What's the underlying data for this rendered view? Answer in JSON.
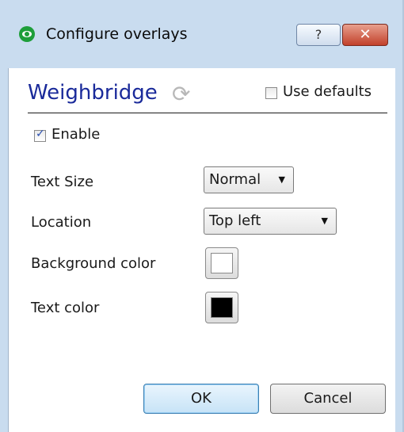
{
  "window": {
    "title": "Configure overlays",
    "help_label": "?",
    "close_label": "✕"
  },
  "header": {
    "title": "Weighbridge",
    "use_defaults_label": "Use defaults",
    "use_defaults_checked": false
  },
  "enable": {
    "label": "Enable",
    "checked": true
  },
  "fields": {
    "text_size": {
      "label": "Text Size",
      "value": "Normal"
    },
    "location": {
      "label": "Location",
      "value": "Top left"
    },
    "background_color": {
      "label": "Background color",
      "color": "#ffffff"
    },
    "text_color": {
      "label": "Text color",
      "color": "#000000"
    }
  },
  "buttons": {
    "ok": "OK",
    "cancel": "Cancel"
  },
  "icons": {
    "app": "eye-icon",
    "refresh": "refresh-arrows-icon",
    "dropdown": "chevron-down-icon"
  }
}
